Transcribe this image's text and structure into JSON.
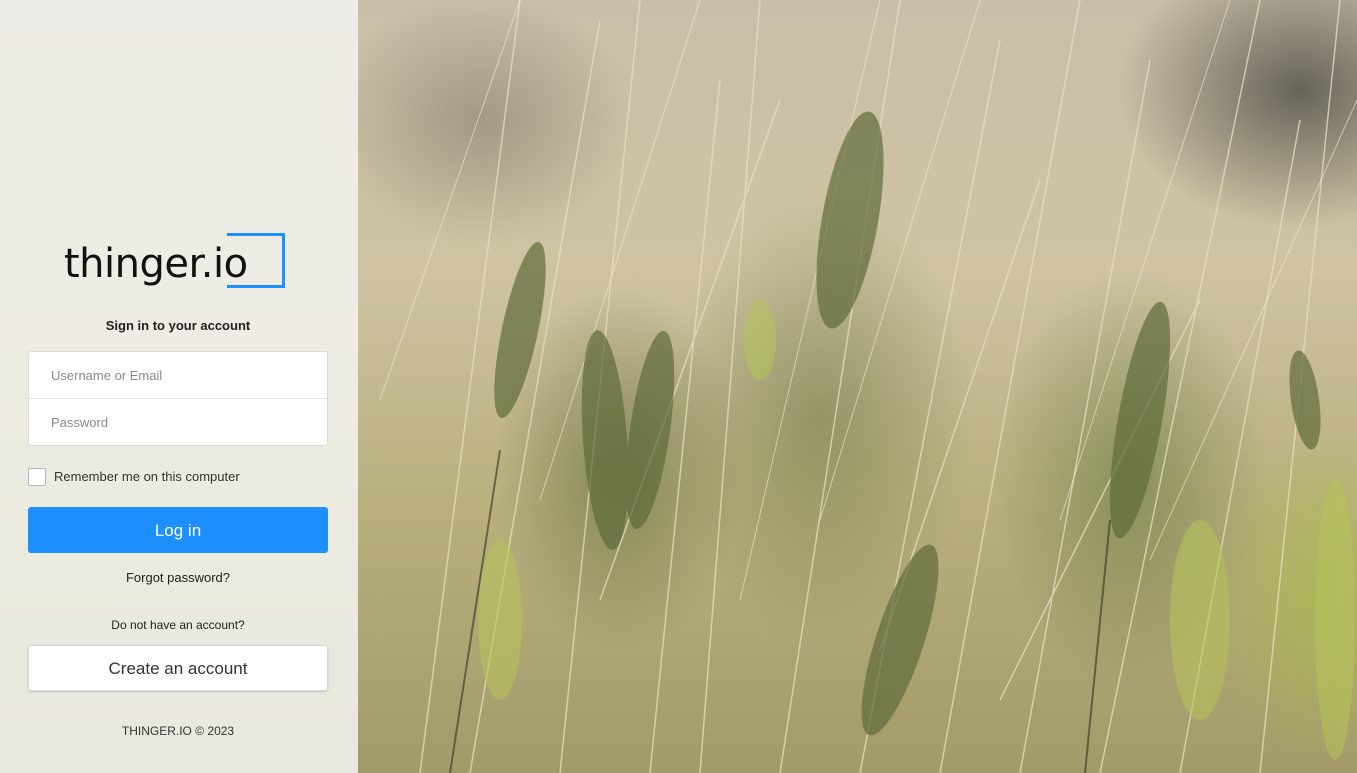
{
  "brand": {
    "logo_text": "thinger.io",
    "accent_color": "#1e90ff"
  },
  "login": {
    "title": "Sign in to your account",
    "username_placeholder": "Username or Email",
    "password_placeholder": "Password",
    "username_value": "",
    "password_value": "",
    "remember_label": "Remember me on this computer",
    "remember_checked": false,
    "login_button": "Log in",
    "forgot_link": "Forgot password?",
    "no_account_text": "Do not have an account?",
    "create_account_button": "Create an account"
  },
  "footer": {
    "copyright": "THINGER.IO © 2023"
  },
  "background": {
    "description_icon": "wheat-field-image"
  }
}
